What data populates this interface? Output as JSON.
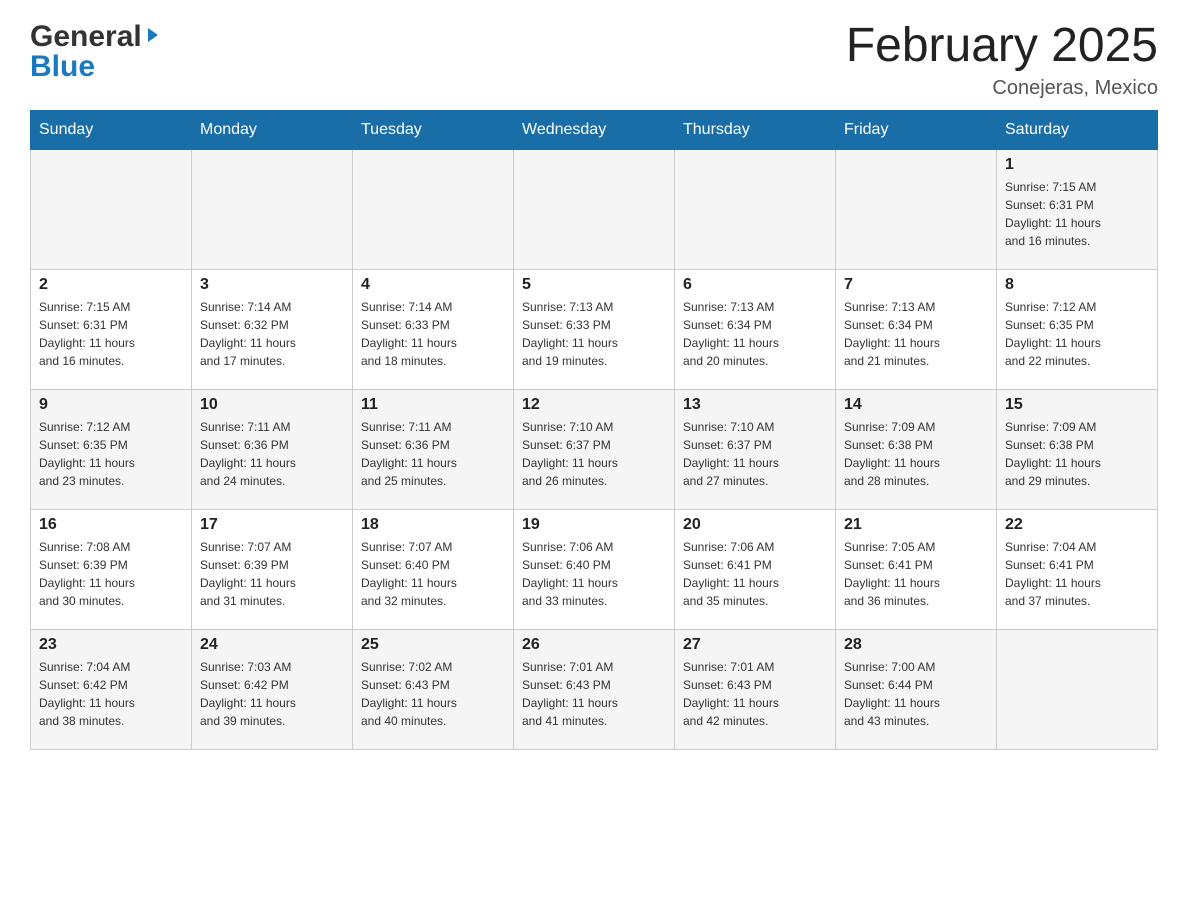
{
  "logo": {
    "general": "General",
    "blue": "Blue"
  },
  "header": {
    "title": "February 2025",
    "location": "Conejeras, Mexico"
  },
  "days_of_week": [
    "Sunday",
    "Monday",
    "Tuesday",
    "Wednesday",
    "Thursday",
    "Friday",
    "Saturday"
  ],
  "weeks": [
    [
      {
        "day": "",
        "info": ""
      },
      {
        "day": "",
        "info": ""
      },
      {
        "day": "",
        "info": ""
      },
      {
        "day": "",
        "info": ""
      },
      {
        "day": "",
        "info": ""
      },
      {
        "day": "",
        "info": ""
      },
      {
        "day": "1",
        "info": "Sunrise: 7:15 AM\nSunset: 6:31 PM\nDaylight: 11 hours\nand 16 minutes."
      }
    ],
    [
      {
        "day": "2",
        "info": "Sunrise: 7:15 AM\nSunset: 6:31 PM\nDaylight: 11 hours\nand 16 minutes."
      },
      {
        "day": "3",
        "info": "Sunrise: 7:14 AM\nSunset: 6:32 PM\nDaylight: 11 hours\nand 17 minutes."
      },
      {
        "day": "4",
        "info": "Sunrise: 7:14 AM\nSunset: 6:33 PM\nDaylight: 11 hours\nand 18 minutes."
      },
      {
        "day": "5",
        "info": "Sunrise: 7:13 AM\nSunset: 6:33 PM\nDaylight: 11 hours\nand 19 minutes."
      },
      {
        "day": "6",
        "info": "Sunrise: 7:13 AM\nSunset: 6:34 PM\nDaylight: 11 hours\nand 20 minutes."
      },
      {
        "day": "7",
        "info": "Sunrise: 7:13 AM\nSunset: 6:34 PM\nDaylight: 11 hours\nand 21 minutes."
      },
      {
        "day": "8",
        "info": "Sunrise: 7:12 AM\nSunset: 6:35 PM\nDaylight: 11 hours\nand 22 minutes."
      }
    ],
    [
      {
        "day": "9",
        "info": "Sunrise: 7:12 AM\nSunset: 6:35 PM\nDaylight: 11 hours\nand 23 minutes."
      },
      {
        "day": "10",
        "info": "Sunrise: 7:11 AM\nSunset: 6:36 PM\nDaylight: 11 hours\nand 24 minutes."
      },
      {
        "day": "11",
        "info": "Sunrise: 7:11 AM\nSunset: 6:36 PM\nDaylight: 11 hours\nand 25 minutes."
      },
      {
        "day": "12",
        "info": "Sunrise: 7:10 AM\nSunset: 6:37 PM\nDaylight: 11 hours\nand 26 minutes."
      },
      {
        "day": "13",
        "info": "Sunrise: 7:10 AM\nSunset: 6:37 PM\nDaylight: 11 hours\nand 27 minutes."
      },
      {
        "day": "14",
        "info": "Sunrise: 7:09 AM\nSunset: 6:38 PM\nDaylight: 11 hours\nand 28 minutes."
      },
      {
        "day": "15",
        "info": "Sunrise: 7:09 AM\nSunset: 6:38 PM\nDaylight: 11 hours\nand 29 minutes."
      }
    ],
    [
      {
        "day": "16",
        "info": "Sunrise: 7:08 AM\nSunset: 6:39 PM\nDaylight: 11 hours\nand 30 minutes."
      },
      {
        "day": "17",
        "info": "Sunrise: 7:07 AM\nSunset: 6:39 PM\nDaylight: 11 hours\nand 31 minutes."
      },
      {
        "day": "18",
        "info": "Sunrise: 7:07 AM\nSunset: 6:40 PM\nDaylight: 11 hours\nand 32 minutes."
      },
      {
        "day": "19",
        "info": "Sunrise: 7:06 AM\nSunset: 6:40 PM\nDaylight: 11 hours\nand 33 minutes."
      },
      {
        "day": "20",
        "info": "Sunrise: 7:06 AM\nSunset: 6:41 PM\nDaylight: 11 hours\nand 35 minutes."
      },
      {
        "day": "21",
        "info": "Sunrise: 7:05 AM\nSunset: 6:41 PM\nDaylight: 11 hours\nand 36 minutes."
      },
      {
        "day": "22",
        "info": "Sunrise: 7:04 AM\nSunset: 6:41 PM\nDaylight: 11 hours\nand 37 minutes."
      }
    ],
    [
      {
        "day": "23",
        "info": "Sunrise: 7:04 AM\nSunset: 6:42 PM\nDaylight: 11 hours\nand 38 minutes."
      },
      {
        "day": "24",
        "info": "Sunrise: 7:03 AM\nSunset: 6:42 PM\nDaylight: 11 hours\nand 39 minutes."
      },
      {
        "day": "25",
        "info": "Sunrise: 7:02 AM\nSunset: 6:43 PM\nDaylight: 11 hours\nand 40 minutes."
      },
      {
        "day": "26",
        "info": "Sunrise: 7:01 AM\nSunset: 6:43 PM\nDaylight: 11 hours\nand 41 minutes."
      },
      {
        "day": "27",
        "info": "Sunrise: 7:01 AM\nSunset: 6:43 PM\nDaylight: 11 hours\nand 42 minutes."
      },
      {
        "day": "28",
        "info": "Sunrise: 7:00 AM\nSunset: 6:44 PM\nDaylight: 11 hours\nand 43 minutes."
      },
      {
        "day": "",
        "info": ""
      }
    ]
  ]
}
